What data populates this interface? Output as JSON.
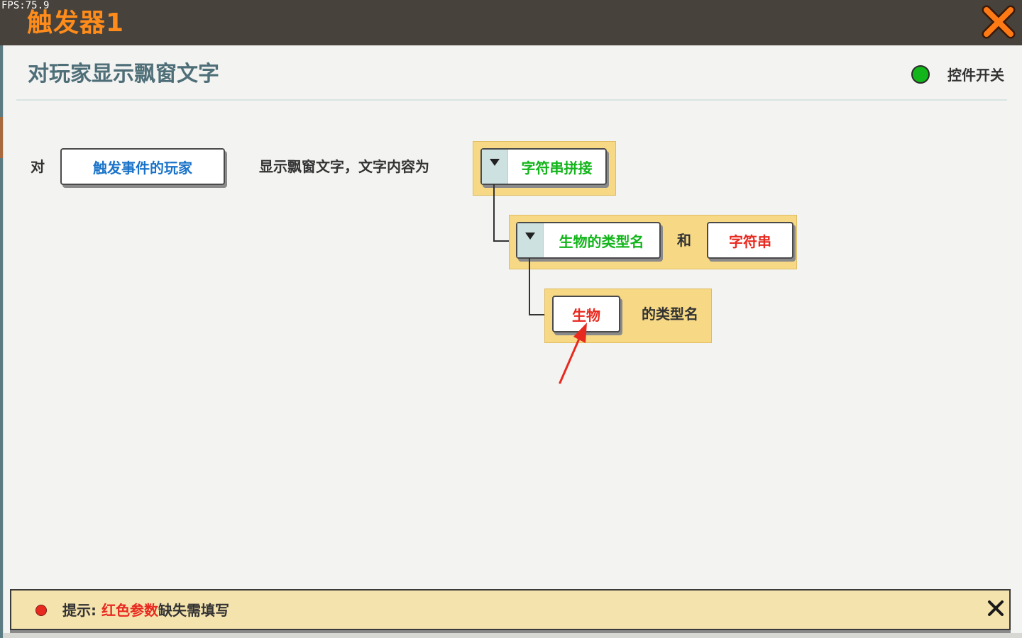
{
  "window": {
    "fps": "FPS:75.9",
    "title": "触发器1"
  },
  "panel": {
    "title": "对玩家显示飘窗文字",
    "switch_label": "控件开关"
  },
  "rule": {
    "prefix": "对",
    "target_button": "触发事件的玩家",
    "middle_text": "显示飘窗文字，文字内容为",
    "level1_dropdown": "字符串拼接",
    "level2_dropdown": "生物的类型名",
    "level2_and": "和",
    "level2_string_button": "字符串",
    "level3_creature_button": "生物",
    "level3_suffix": "的类型名"
  },
  "hint": {
    "prefix": "提示:",
    "red_part": "红色参数",
    "suffix": "缺失需填写"
  },
  "colors": {
    "title_orange": "#ff8c1a",
    "blue_link": "#1a73c9",
    "green_text": "#12b51a",
    "red_text": "#e8291f",
    "yellow_box": "#f6d885",
    "switch_on": "#12b51a"
  },
  "icons": {
    "close": "close-icon",
    "dropdown": "triangle-down-icon",
    "switch": "status-dot-icon",
    "annotation": "red-arrow-icon"
  }
}
